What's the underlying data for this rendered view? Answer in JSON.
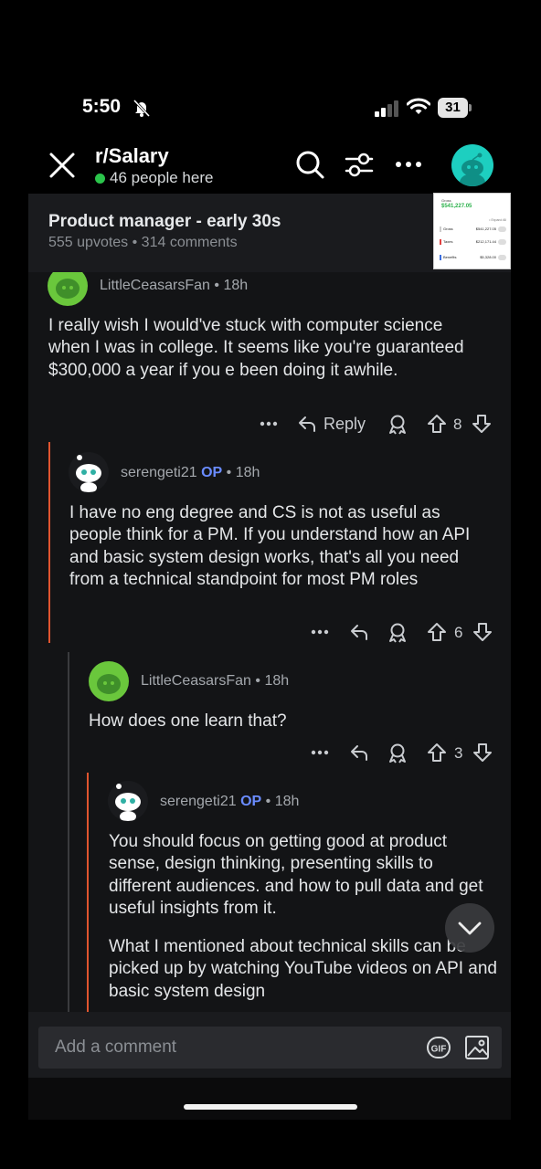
{
  "status_bar": {
    "time": "5:50",
    "battery": "31"
  },
  "header": {
    "subreddit": "r/Salary",
    "online": "46 people here"
  },
  "post": {
    "title": "Product manager - early 30s",
    "meta": "555 upvotes • 314 comments",
    "thumbnail": {
      "label": "Gross",
      "total": "$541,227.05",
      "note": "• Expand All",
      "rows": [
        {
          "label": "Gross",
          "value": "$541,227.05",
          "color": "#cccccc"
        },
        {
          "label": "Taxes",
          "value": "$212,171.44",
          "color": "#e04040"
        },
        {
          "label": "Benefits",
          "value": "$5,328.00",
          "color": "#3b6fe0"
        }
      ]
    }
  },
  "comments": [
    {
      "user": "LittleCeasarsFan",
      "op": "",
      "time": " • 18h",
      "body": "I really wish I would've stuck with computer science when I was in college.  It seems like you're guaranteed $300,000 a year if you e been doing it awhile.",
      "reply": "Reply",
      "votes": "8"
    },
    {
      "user": "serengeti21",
      "op": "OP",
      "time": " • 18h",
      "body": "I have no eng degree and CS is not as useful as people think for a PM. If you understand how an API and basic system design works, that's all you need from a technical standpoint for most PM roles",
      "reply": "",
      "votes": "6"
    },
    {
      "user": "LittleCeasarsFan",
      "op": "",
      "time": " • 18h",
      "body": "How does one learn that?",
      "reply": "",
      "votes": "3"
    },
    {
      "user": "serengeti21",
      "op": "OP",
      "time": " • 18h",
      "body": "You should focus on getting good at product sense, design thinking, presenting skills to different audiences. and how to pull data and get useful insights from it.",
      "body2": "What I mentioned about technical skills can be picked up by watching YouTube videos on API and basic system design",
      "reply": "",
      "votes": ""
    }
  ],
  "composer": {
    "placeholder": "Add a comment",
    "gif": "GIF"
  },
  "colors": {
    "accent_op": "#6a8cff",
    "thread_line_op": "#e0552f",
    "thread_line": "#3a3b3e",
    "online": "#2bc44b"
  }
}
